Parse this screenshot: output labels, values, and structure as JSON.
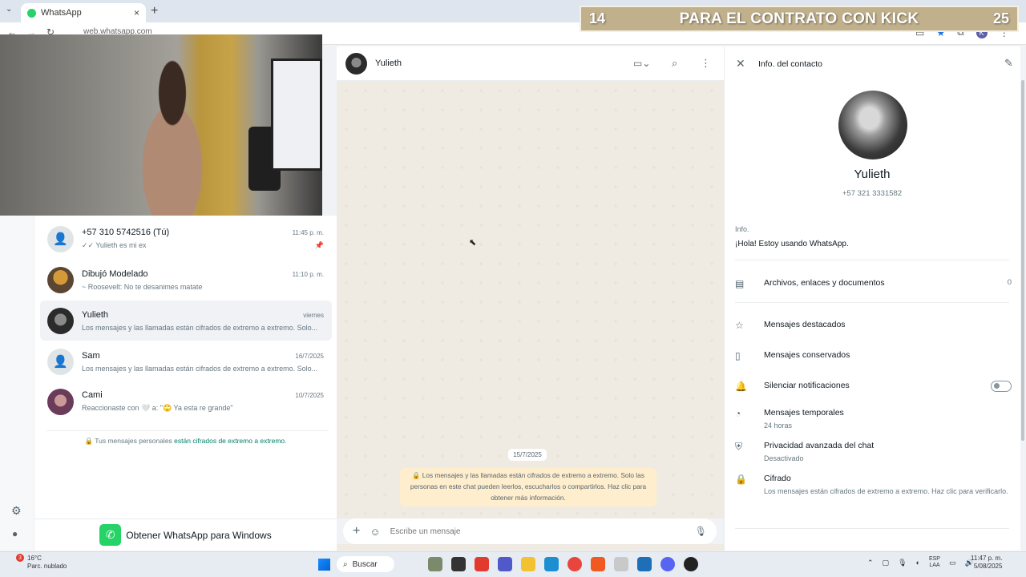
{
  "browser": {
    "tab_title": "WhatsApp",
    "tab_close": "×",
    "new_tab": "+",
    "url": "web.whatsapp.com",
    "profile_initial": "K"
  },
  "banner": {
    "left_number": "14",
    "title": "PARA EL CONTRATO CON KICK",
    "right_number": "25"
  },
  "chats": [
    {
      "name": "+57 310 5742516 (Tú)",
      "time": "11:45 p. m.",
      "last": "✓✓ Yulieth es mi ex",
      "pinned": true
    },
    {
      "name": "Dibujó Modelado",
      "time": "11:10 p. m.",
      "last": "~ Roosevelt: No te desanimes matate",
      "pinned": false
    },
    {
      "name": "Yulieth",
      "time": "viernes",
      "last": "Los mensajes y las llamadas están cifrados de extremo a extremo. Solo...",
      "pinned": false
    },
    {
      "name": "Sam",
      "time": "16/7/2025",
      "last": "Los mensajes y las llamadas están cifrados de extremo a extremo. Solo...",
      "pinned": false
    },
    {
      "name": "Cami",
      "time": "10/7/2025",
      "last": "Reaccionaste con 🤍 a: \"🙄 Ya esta re grande\"",
      "pinned": false
    }
  ],
  "chatlist": {
    "enc_prefix": "🔒 Tus mensajes personales ",
    "enc_link": "están cifrados de extremo a extremo",
    "enc_suffix": ".",
    "get_app": "Obtener WhatsApp para Windows"
  },
  "conversation": {
    "name": "Yulieth",
    "date_chip": "15/7/2025",
    "system_message": "🔒 Los mensajes y las llamadas están cifrados de extremo a extremo. Solo las personas en este chat pueden leerlos, escucharlos o compartirlos. Haz clic para obtener más información.",
    "compose_placeholder": "Escribe un mensaje"
  },
  "contact_info": {
    "title": "Info. del contacto",
    "name": "Yulieth",
    "phone": "+57 321 3331582",
    "about_label": "Info.",
    "about": "¡Hola! Estoy usando WhatsApp.",
    "files_label": "Archivos, enlaces y documentos",
    "files_count": "0",
    "starred": "Mensajes destacados",
    "kept": "Mensajes conservados",
    "mute": "Silenciar notificaciones",
    "disappearing": "Mensajes temporales",
    "disappearing_value": "24 horas",
    "privacy": "Privacidad avanzada del chat",
    "privacy_value": "Desactivado",
    "encryption": "Cifrado",
    "encryption_desc": "Los mensajes están cifrados de extremo a extremo. Haz clic para verificarlo."
  },
  "taskbar": {
    "temperature": "16°C",
    "weather": "Parc. nublado",
    "weather_badge": "3",
    "search": "Buscar",
    "lang_1": "ESP",
    "lang_2": "LAA",
    "time": "11:47 p. m.",
    "date": "5/08/2025"
  },
  "colors": {
    "whatsapp_green": "#25d366",
    "chat_bg": "#efeae2",
    "system_msg_bg": "#ffeecd",
    "banner": "#c0b08c"
  }
}
